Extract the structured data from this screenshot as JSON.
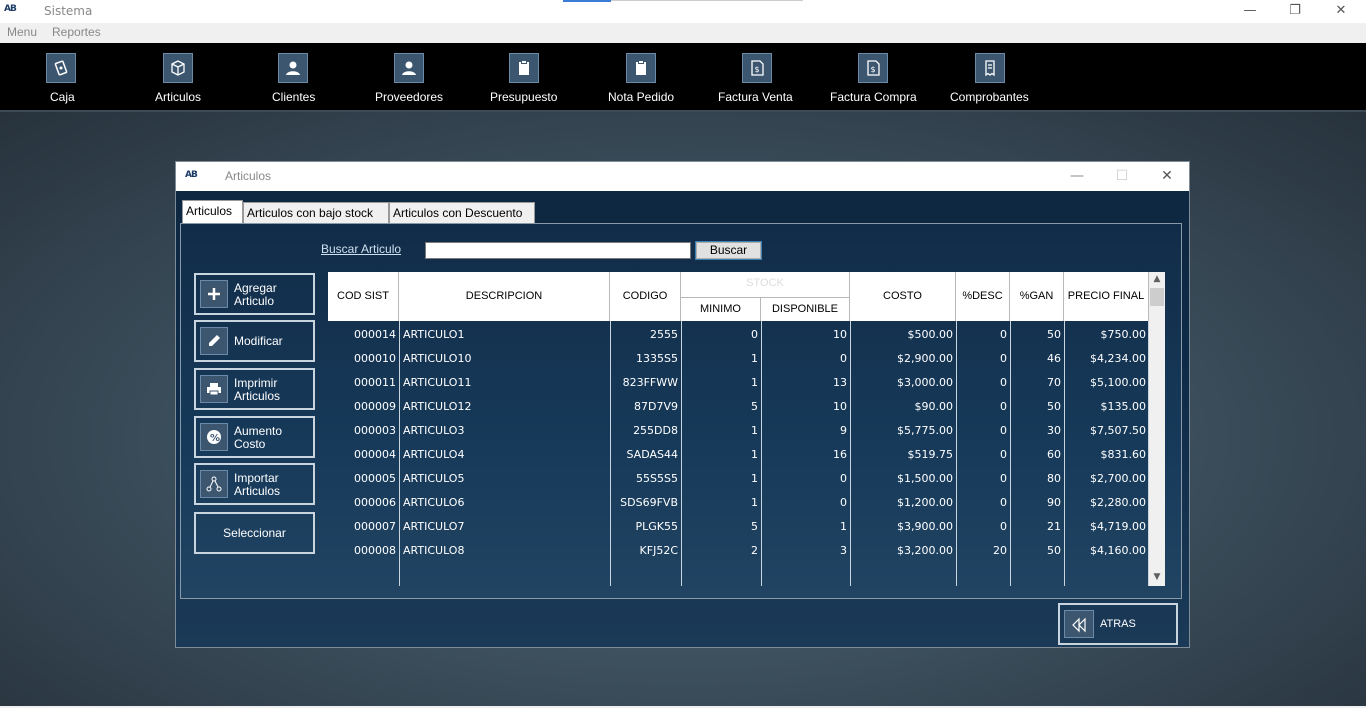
{
  "app": {
    "logo": "AB",
    "title": "Sistema",
    "minimize": "—",
    "restore": "❐",
    "close": "✕"
  },
  "menu": [
    "Menu",
    "Reportes"
  ],
  "toolbar": [
    {
      "label": "Caja",
      "icon": "cash-icon"
    },
    {
      "label": "Articulos",
      "icon": "box-icon"
    },
    {
      "label": "Clientes",
      "icon": "users-icon"
    },
    {
      "label": "Proveedores",
      "icon": "supplier-icon"
    },
    {
      "label": "Presupuesto",
      "icon": "clipboard-icon"
    },
    {
      "label": "Nota Pedido",
      "icon": "clipboard-icon"
    },
    {
      "label": "Factura Venta",
      "icon": "invoice-icon"
    },
    {
      "label": "Factura Compra",
      "icon": "invoice-icon"
    },
    {
      "label": "Comprobantes",
      "icon": "receipt-icon"
    }
  ],
  "window": {
    "logo": "AB",
    "title": "Articulos",
    "minimize": "—",
    "maximize": "☐",
    "close": "✕",
    "tabs": [
      "Articulos",
      "Articulos con bajo stock",
      "Articulos con Descuento"
    ],
    "search": {
      "label": "Buscar Articulo",
      "value": "",
      "button": "Buscar"
    },
    "side_buttons": [
      {
        "label": "Agregar\nArticulo",
        "icon": "plus-icon"
      },
      {
        "label": "Modificar",
        "icon": "pencil-icon"
      },
      {
        "label": "Imprimir\nArticulos",
        "icon": "printer-icon"
      },
      {
        "label": "Aumento\nCosto",
        "icon": "percent-icon"
      },
      {
        "label": "Importar\nArticulos",
        "icon": "import-icon"
      }
    ],
    "select_button": "Seleccionar",
    "back_button": "ATRAS",
    "table": {
      "headers": {
        "cod": "COD SIST",
        "desc": "DESCRIPCION",
        "codigo": "CODIGO",
        "stock": "STOCK",
        "minimo": "MINIMO",
        "disponible": "DISPONIBLE",
        "costo": "COSTO",
        "desc_pct": "%DESC",
        "gan": "%GAN",
        "precio": "PRECIO FINAL"
      },
      "rows": [
        [
          "000014",
          "ARTICULO1",
          "2555",
          "0",
          "10",
          "$500.00",
          "0",
          "50",
          "$750.00"
        ],
        [
          "000010",
          "ARTICULO10",
          "1335S5",
          "1",
          "0",
          "$2,900.00",
          "0",
          "46",
          "$4,234.00"
        ],
        [
          "000011",
          "ARTICULO11",
          "823FFWW",
          "1",
          "13",
          "$3,000.00",
          "0",
          "70",
          "$5,100.00"
        ],
        [
          "000009",
          "ARTICULO12",
          "87D7V9",
          "5",
          "10",
          "$90.00",
          "0",
          "50",
          "$135.00"
        ],
        [
          "000003",
          "ARTICULO3",
          "255DD8",
          "1",
          "9",
          "$5,775.00",
          "0",
          "30",
          "$7,507.50"
        ],
        [
          "000004",
          "ARTICULO4",
          "SADAS44",
          "1",
          "16",
          "$519.75",
          "0",
          "60",
          "$831.60"
        ],
        [
          "000005",
          "ARTICULO5",
          "55S5S5",
          "1",
          "0",
          "$1,500.00",
          "0",
          "80",
          "$2,700.00"
        ],
        [
          "000006",
          "ARTICULO6",
          "SDS69FVB",
          "1",
          "0",
          "$1,200.00",
          "0",
          "90",
          "$2,280.00"
        ],
        [
          "000007",
          "ARTICULO7",
          "PLGK55",
          "5",
          "1",
          "$3,900.00",
          "0",
          "21",
          "$4,719.00"
        ],
        [
          "000008",
          "ARTICULO8",
          "KFJ52C",
          "2",
          "3",
          "$3,200.00",
          "20",
          "50",
          "$4,160.00"
        ]
      ]
    }
  }
}
